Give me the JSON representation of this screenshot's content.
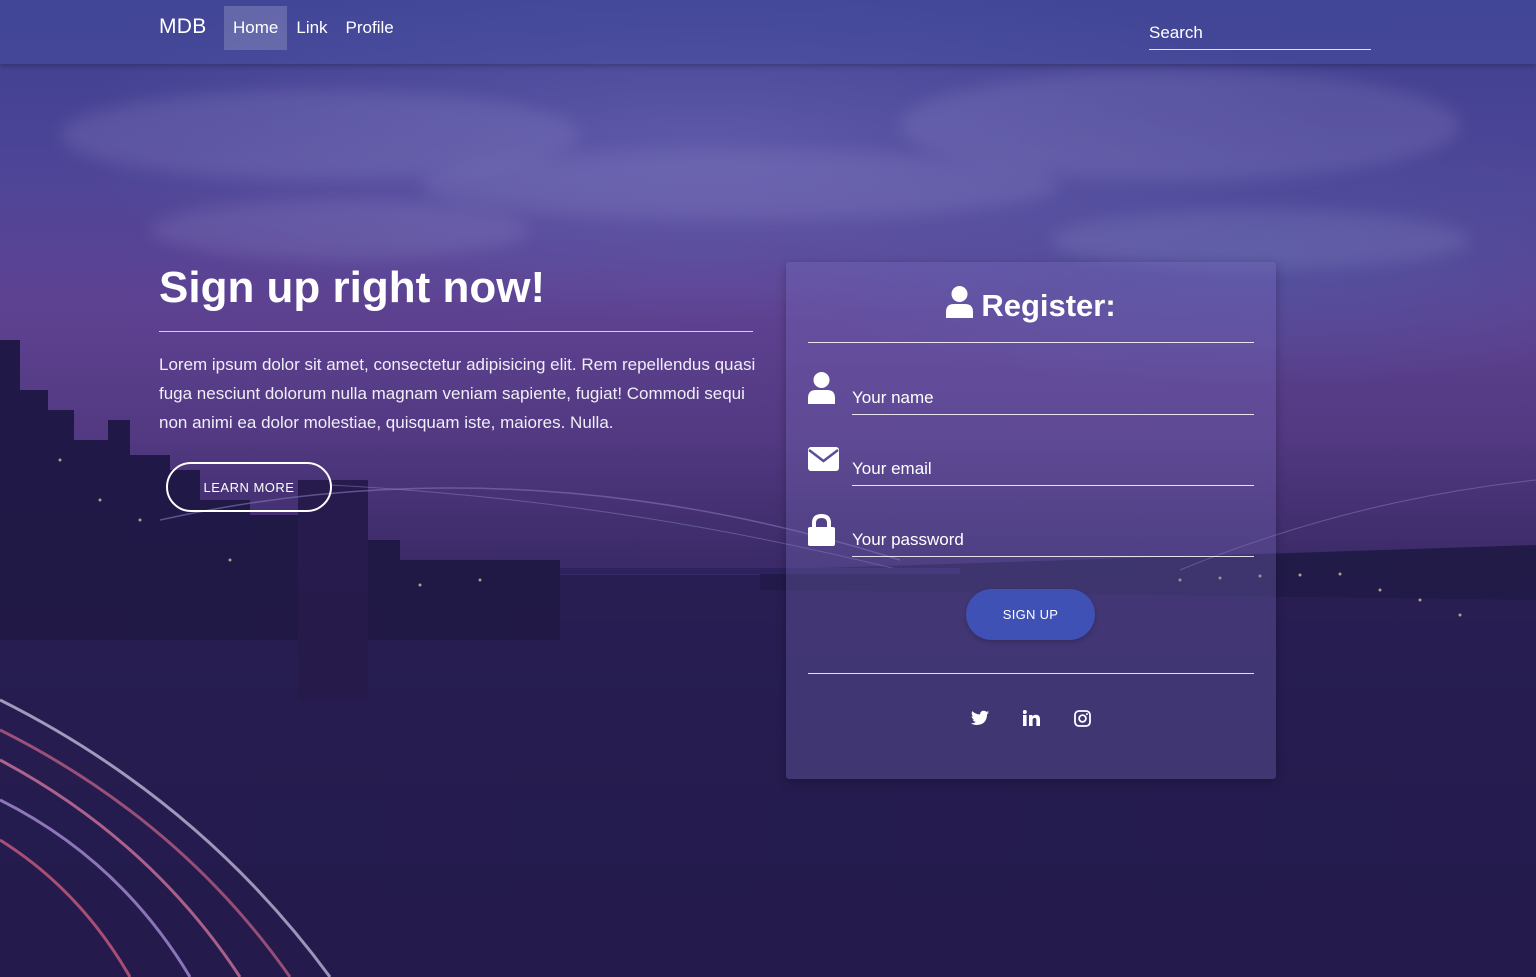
{
  "navbar": {
    "brand": "MDB",
    "links": [
      {
        "label": "Home",
        "active": true
      },
      {
        "label": "Link",
        "active": false
      },
      {
        "label": "Profile",
        "active": false
      }
    ],
    "search_placeholder": "Search"
  },
  "hero": {
    "title": "Sign up right now!",
    "text": "Lorem ipsum dolor sit amet, consectetur adipisicing elit. Rem repellendus quasi fuga nesciunt dolorum nulla magnam veniam sapiente, fugiat! Commodi sequi non animi ea dolor molestiae, quisquam iste, maiores. Nulla.",
    "button_label": "LEARN MORE"
  },
  "register": {
    "title": "Register:",
    "title_icon": "user-icon",
    "fields": [
      {
        "icon": "user-icon",
        "placeholder": "Your name"
      },
      {
        "icon": "envelope-icon",
        "placeholder": "Your email"
      },
      {
        "icon": "lock-icon",
        "placeholder": "Your password"
      }
    ],
    "submit_label": "SIGN UP",
    "social": [
      "twitter-icon",
      "linkedin-icon",
      "instagram-icon"
    ]
  },
  "colors": {
    "primary_button": "#3f51b5"
  }
}
